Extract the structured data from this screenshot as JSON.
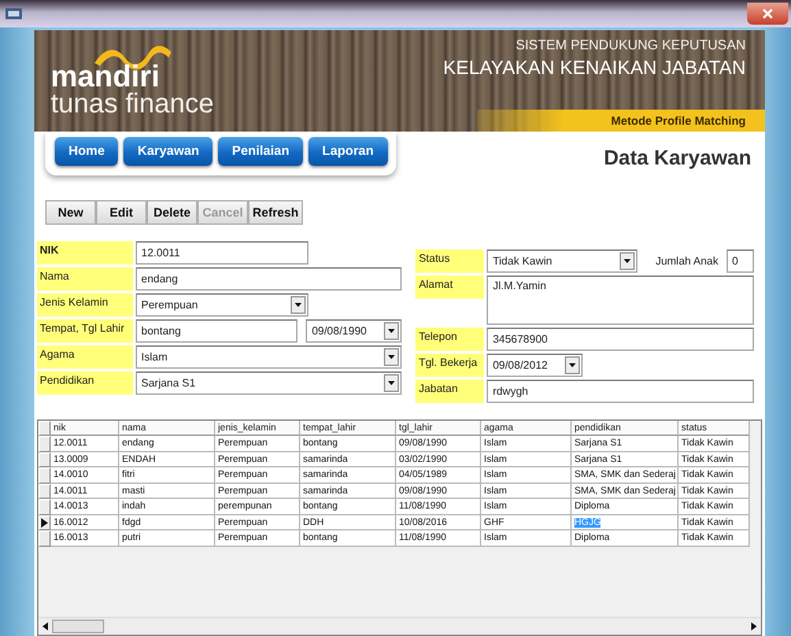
{
  "header": {
    "logo_line_1": "mandiri",
    "logo_line_2": "tunas finance",
    "subtitle": "SISTEM PENDUKUNG KEPUTUSAN",
    "title": "KELAYAKAN KENAIKAN JABATAN",
    "method": "Metode Profile Matching"
  },
  "nav": [
    "Home",
    "Karyawan",
    "Penilaian",
    "Laporan"
  ],
  "page_title": "Data Karyawan",
  "toolbar": [
    {
      "label": "New",
      "disabled": false
    },
    {
      "label": "Edit",
      "disabled": false
    },
    {
      "label": "Delete",
      "disabled": false
    },
    {
      "label": "Cancel",
      "disabled": true
    },
    {
      "label": "Refresh",
      "disabled": false
    }
  ],
  "form_left": [
    {
      "label": "NIK",
      "bold": true,
      "fields": [
        {
          "kind": "text",
          "value": "12.0011"
        }
      ]
    },
    {
      "label": "Nama",
      "bold": false,
      "fields": [
        {
          "kind": "text",
          "value": "endang"
        }
      ]
    },
    {
      "label": "Jenis Kelamin",
      "bold": false,
      "fields": [
        {
          "kind": "dropdown",
          "value": "Perempuan"
        }
      ]
    },
    {
      "label": "Tempat, Tgl Lahir",
      "bold": false,
      "fields": [
        {
          "kind": "text",
          "value": "bontang"
        },
        {
          "kind": "dropdown",
          "value": "09/08/1990"
        }
      ]
    },
    {
      "label": "Agama",
      "bold": false,
      "fields": [
        {
          "kind": "dropdown",
          "value": "Islam"
        }
      ]
    },
    {
      "label": "Pendidikan",
      "bold": false,
      "fields": [
        {
          "kind": "dropdown",
          "value": "Sarjana S1"
        }
      ]
    }
  ],
  "form_right": [
    {
      "label": "Status",
      "bold": false,
      "fields": [
        {
          "kind": "dropdown",
          "value": "Tidak Kawin"
        },
        {
          "kind": "caption",
          "value": "Jumlah Anak"
        },
        {
          "kind": "text",
          "value": "0"
        }
      ]
    },
    {
      "label": "Alamat",
      "bold": false,
      "fields": [
        {
          "kind": "memo",
          "value": "Jl.M.Yamin"
        }
      ]
    },
    {
      "label": "Telepon",
      "bold": false,
      "fields": [
        {
          "kind": "text",
          "value": "345678900"
        }
      ]
    },
    {
      "label": "Tgl. Bekerja",
      "bold": false,
      "fields": [
        {
          "kind": "dropdown",
          "value": "09/08/2012"
        }
      ]
    },
    {
      "label": "Jabatan",
      "bold": false,
      "fields": [
        {
          "kind": "text",
          "value": "rdwygh"
        }
      ]
    }
  ],
  "grid": {
    "columns": [
      "nik",
      "nama",
      "jenis_kelamin",
      "tempat_lahir",
      "tgl_lahir",
      "agama",
      "pendidikan",
      "status"
    ],
    "rows": [
      {
        "selected": false,
        "cells": [
          {
            "text": "12.0011",
            "highlighted": false
          },
          {
            "text": "endang",
            "highlighted": false
          },
          {
            "text": "Perempuan",
            "highlighted": false
          },
          {
            "text": "bontang",
            "highlighted": false
          },
          {
            "text": "09/08/1990",
            "highlighted": false
          },
          {
            "text": "Islam",
            "highlighted": false
          },
          {
            "text": "Sarjana S1",
            "highlighted": false
          },
          {
            "text": "Tidak Kawin",
            "highlighted": false
          }
        ]
      },
      {
        "selected": false,
        "cells": [
          {
            "text": "13.0009",
            "highlighted": false
          },
          {
            "text": "ENDAH",
            "highlighted": false
          },
          {
            "text": "Perempuan",
            "highlighted": false
          },
          {
            "text": "samarinda",
            "highlighted": false
          },
          {
            "text": "03/02/1990",
            "highlighted": false
          },
          {
            "text": "Islam",
            "highlighted": false
          },
          {
            "text": "Sarjana S1",
            "highlighted": false
          },
          {
            "text": "Tidak Kawin",
            "highlighted": false
          }
        ]
      },
      {
        "selected": false,
        "cells": [
          {
            "text": "14.0010",
            "highlighted": false
          },
          {
            "text": "fitri",
            "highlighted": false
          },
          {
            "text": "Perempuan",
            "highlighted": false
          },
          {
            "text": "samarinda",
            "highlighted": false
          },
          {
            "text": "04/05/1989",
            "highlighted": false
          },
          {
            "text": "Islam",
            "highlighted": false
          },
          {
            "text": "SMA, SMK dan Sederaj",
            "highlighted": false
          },
          {
            "text": "Tidak Kawin",
            "highlighted": false
          }
        ]
      },
      {
        "selected": false,
        "cells": [
          {
            "text": "14.0011",
            "highlighted": false
          },
          {
            "text": "masti",
            "highlighted": false
          },
          {
            "text": "Perempuan",
            "highlighted": false
          },
          {
            "text": "samarinda",
            "highlighted": false
          },
          {
            "text": "09/08/1990",
            "highlighted": false
          },
          {
            "text": "Islam",
            "highlighted": false
          },
          {
            "text": "SMA, SMK dan Sederaj",
            "highlighted": false
          },
          {
            "text": "Tidak Kawin",
            "highlighted": false
          }
        ]
      },
      {
        "selected": false,
        "cells": [
          {
            "text": "14.0013",
            "highlighted": false
          },
          {
            "text": "indah",
            "highlighted": false
          },
          {
            "text": "perempunan",
            "highlighted": false
          },
          {
            "text": "bontang",
            "highlighted": false
          },
          {
            "text": "11/08/1990",
            "highlighted": false
          },
          {
            "text": "Islam",
            "highlighted": false
          },
          {
            "text": "Diploma",
            "highlighted": false
          },
          {
            "text": "Tidak Kawin",
            "highlighted": false
          }
        ]
      },
      {
        "selected": true,
        "cells": [
          {
            "text": "16.0012",
            "highlighted": false
          },
          {
            "text": "fdgd",
            "highlighted": false
          },
          {
            "text": "Perempuan",
            "highlighted": false
          },
          {
            "text": "DDH",
            "highlighted": false
          },
          {
            "text": "10/08/2016",
            "highlighted": false
          },
          {
            "text": "GHF",
            "highlighted": false
          },
          {
            "text": "HGJG",
            "highlighted": true
          },
          {
            "text": "Tidak Kawin",
            "highlighted": false
          }
        ]
      },
      {
        "selected": false,
        "cells": [
          {
            "text": "16.0013",
            "highlighted": false
          },
          {
            "text": "putri",
            "highlighted": false
          },
          {
            "text": "Perempuan",
            "highlighted": false
          },
          {
            "text": "bontang",
            "highlighted": false
          },
          {
            "text": "11/08/1990",
            "highlighted": false
          },
          {
            "text": "Islam",
            "highlighted": false
          },
          {
            "text": "Diploma",
            "highlighted": false
          },
          {
            "text": "Tidak Kawin",
            "highlighted": false
          }
        ]
      }
    ]
  }
}
